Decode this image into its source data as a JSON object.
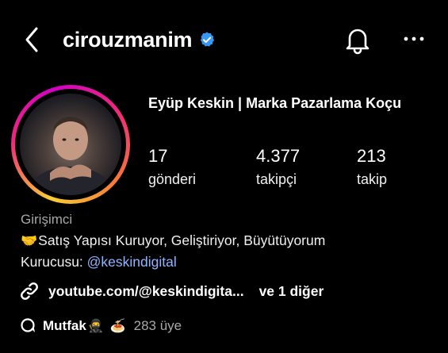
{
  "header": {
    "username": "cirouzmanim",
    "icons": {
      "back": "chevron-left-icon",
      "verified": "verified-badge-icon",
      "notifications": "bell-icon",
      "more": "more-horizontal-icon"
    }
  },
  "profile": {
    "display_name": "Eyüp Keskin | Marka Pazarlama Koçu",
    "stats": {
      "posts": {
        "value": "17",
        "label": "gönderi"
      },
      "followers": {
        "value": "4.377",
        "label": "takipçi"
      },
      "following": {
        "value": "213",
        "label": "takip"
      }
    },
    "category": "Girişimci",
    "bio": {
      "line1_emoji": "🤝",
      "line1": "Satış Yapısı Kuruyor, Geliştiriyor, Büyütüyorum",
      "line2_prefix": "Kurucusu: ",
      "line2_mention": "@keskindigital"
    },
    "link": {
      "icon": "link-icon",
      "text": "youtube.com/@keskindigita...",
      "more": "ve 1 diğer"
    },
    "channel": {
      "icon": "broadcast-channel-icon",
      "name": "Mutfak",
      "emoji1": "🥷",
      "emoji2": "🍝",
      "members": "283 üye"
    }
  },
  "colors": {
    "background": "#000000",
    "text": "#f5f5f5",
    "muted": "#a8a8a8",
    "mention": "#8fb4ff",
    "verified": "#3897f0"
  }
}
